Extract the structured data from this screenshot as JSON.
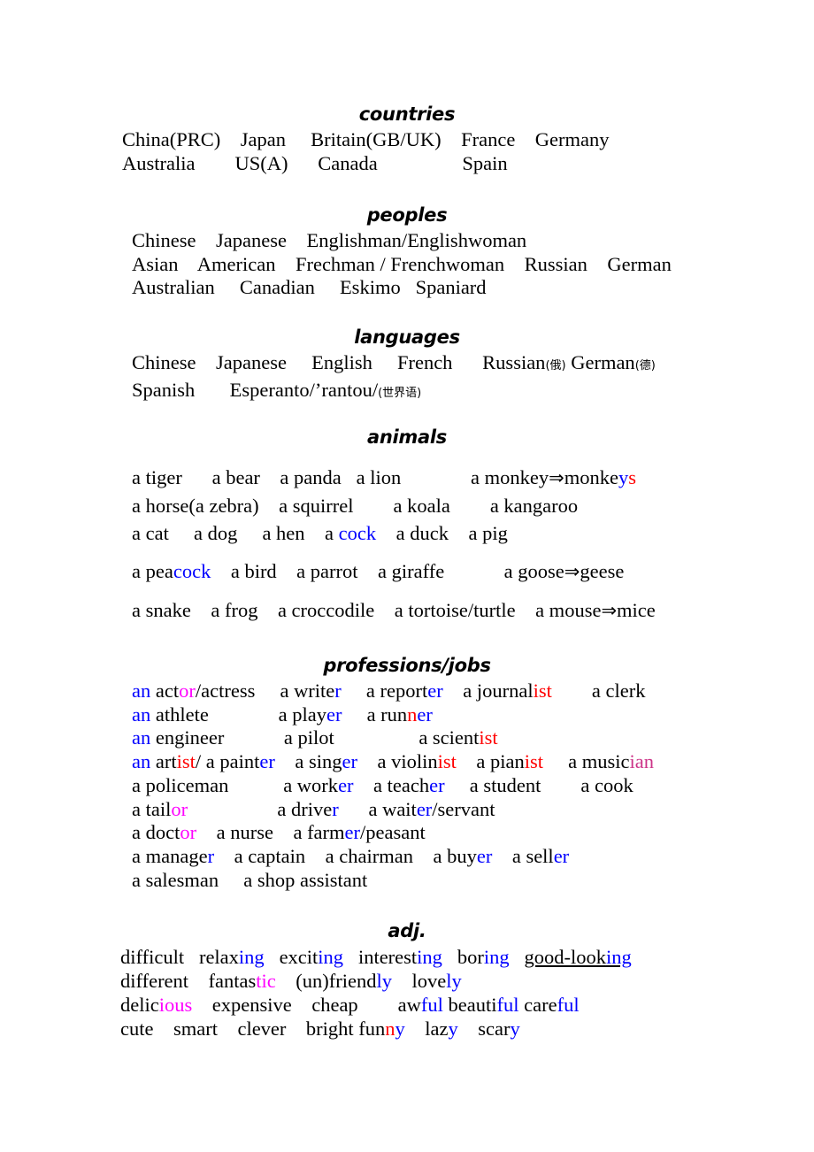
{
  "document": {
    "kind": "vocabulary-worksheet",
    "colors": {
      "text": "#000000",
      "suffix_blue": "#0000ff",
      "suffix_red": "#ff0000",
      "suffix_magenta": "#ff00ff",
      "suffix_magenta_dark": "#cc3388"
    }
  },
  "sections": {
    "countries": {
      "title": "countries",
      "lines": [
        "China(PRC)    Japan     Britain(GB/UK)    France    Germany",
        "Australia        US(A)      Canada                 Spain"
      ]
    },
    "peoples": {
      "title": "peoples",
      "lines": [
        "Chinese    Japanese    Englishman/Englishwoman",
        "Asian    American    Frechman / Frenchwoman    Russian    German",
        "Australian     Canadian     Eskimo   Spaniard"
      ]
    },
    "languages": {
      "title": "languages",
      "lines": [
        "Chinese    Japanese     English     French     Russian(俄) German(德)",
        "Spanish      Esperanto/’rantou/(世界语)"
      ],
      "annotations": {
        "russian_cjk": "俄",
        "german_cjk": "德",
        "esperanto_cjk": "世界语",
        "esperanto_phonetic": "Esperanto/’rantou/"
      }
    },
    "animals": {
      "title": "animals",
      "lines": [
        "a tiger      a bear    a panda   a lion              a monkey⇒monkeys",
        "a horse(a zebra)    a squirrel        a koala        a kangaroo",
        "a cat     a dog     a hen    a cock    a duck    a pig",
        "a peacock    a bird    a parrot    a giraffe            a goose⇒geese",
        "a snake    a frog    a croccodile    a tortoise/turtle    a mouse⇒mice"
      ],
      "plural_notes": [
        "a monkey⇒monkeys",
        "a goose⇒geese",
        "a mouse⇒mice"
      ]
    },
    "professions": {
      "title": "professions/jobs",
      "lines": [
        "an actor/actress      a writer      a reporter    a journalist        a clerk",
        "an athlete              a player      a runner",
        "an engineer            a pilot                 a scientist",
        "an artist/ a painter   a singer    a violinist   a pianist     a musician",
        "a policeman           a worker    a teacher    a student       a cook",
        "a tailor                  a driver      a waiter/servant",
        "a doctor    a nurse    a farmer/peasant",
        "a manager    a captain    a chairman    a buyer    a seller",
        "a salesman     a shop assistant"
      ]
    },
    "adjectives": {
      "title": "adj.",
      "lines": [
        "difficult    relaxing    exciting   interesting    boring    good-looking",
        "different    fantastic    (un)friendly    lovely",
        "delicious    expensive    cheap      awful beautiful careful",
        "cute    smart    clever    bright funny    lazy    scary"
      ]
    }
  },
  "word_parts": {
    "countries_row1": [
      "China(PRC)",
      "Japan",
      "Britain(GB/UK)",
      "France",
      "Germany"
    ],
    "countries_row2": [
      "Australia",
      "US(A)",
      "Canada",
      "Spain"
    ],
    "peoples_row1": [
      "Chinese",
      "Japanese",
      "Englishman/Englishwoman"
    ],
    "peoples_row2": [
      "Asian",
      "American",
      "Frechman / Frenchwoman",
      "Russian",
      "German"
    ],
    "peoples_row3": [
      "Australian",
      "Canadian",
      "Eskimo",
      "Spaniard"
    ],
    "languages_row1": [
      "Chinese",
      "Japanese",
      "English",
      "French",
      "Russian",
      "German"
    ],
    "languages_row2": [
      "Spanish",
      "Esperanto"
    ]
  }
}
